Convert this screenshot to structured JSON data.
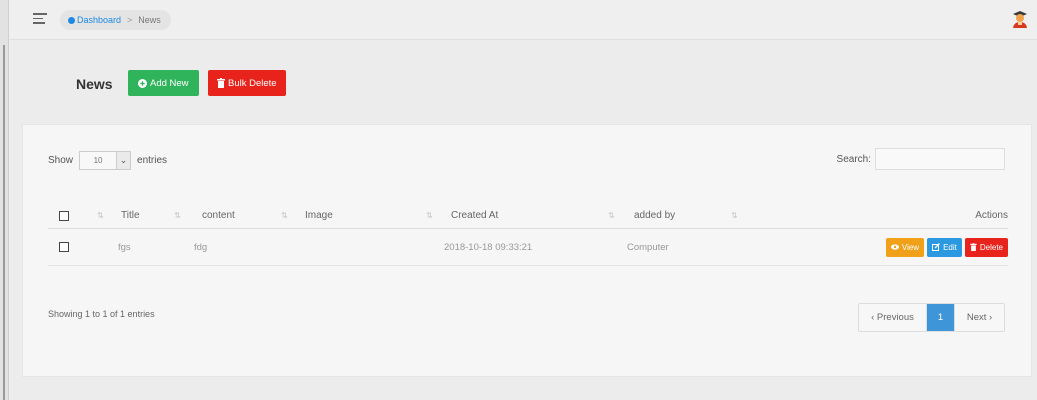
{
  "breadcrumb": {
    "home": "Dashboard",
    "separator": ">",
    "current": "News"
  },
  "page": {
    "title": "News",
    "add_new": "Add New",
    "bulk_delete": "Bulk Delete"
  },
  "length_menu": {
    "show": "Show",
    "value": "10",
    "entries": "entries"
  },
  "search": {
    "label": "Search:",
    "value": ""
  },
  "table": {
    "headers": {
      "title": "Title",
      "content": "content",
      "image": "Image",
      "created_at": "Created At",
      "added_by": "added by",
      "actions": "Actions"
    },
    "rows": [
      {
        "title": "fgs",
        "content": "fdg",
        "image": "",
        "created_at": "2018-10-18 09:33:21",
        "added_by": "Computer"
      }
    ],
    "action_labels": {
      "view": "View",
      "edit": "Edit",
      "delete": "Delete"
    }
  },
  "info": "Showing 1 to 1 of 1 entries",
  "pagination": {
    "previous": "‹ Previous",
    "current": "1",
    "next": "Next ›"
  },
  "colors": {
    "add_new": "#2fb35b",
    "bulk_delete": "#e8231b",
    "view": "#f0a019",
    "edit": "#2b99e0",
    "delete": "#e8231b",
    "page_active": "#3e95d8",
    "link": "#1e88e5"
  },
  "icons": {
    "menu": "hamburger-icon",
    "breadcrumb": "dashboard-dot-icon",
    "add": "plus-circle-icon",
    "bulk_delete": "trash-icon",
    "view": "eye-icon",
    "edit": "edit-icon",
    "delete": "trash-icon",
    "avatar": "user-avatar-icon",
    "dropdown": "chevron-down-icon",
    "sort": "sort-icon"
  }
}
